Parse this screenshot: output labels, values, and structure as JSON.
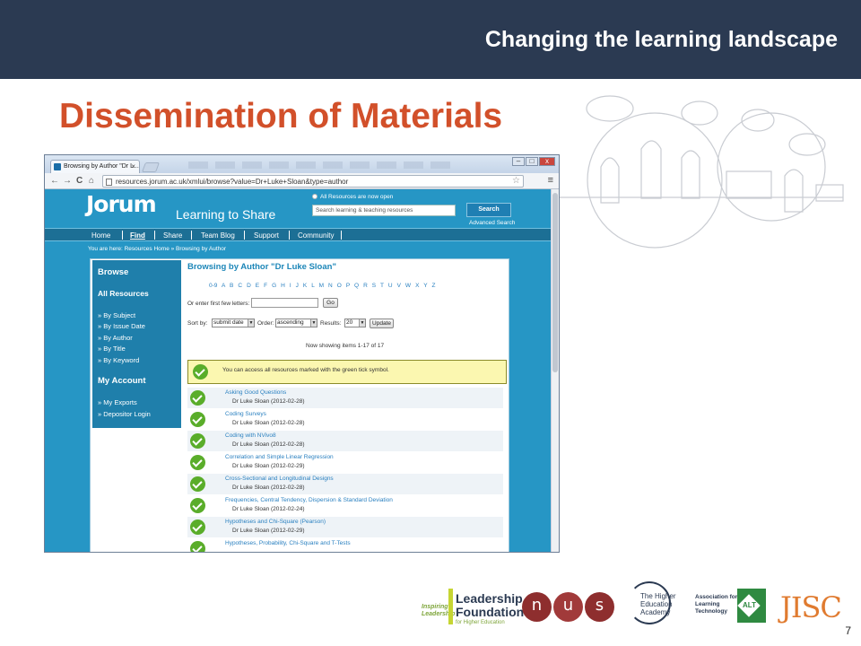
{
  "header": {
    "tagline": "Changing the learning landscape"
  },
  "slide": {
    "title": "Dissemination of Materials",
    "page_number": "7"
  },
  "browser": {
    "tab_title": "Browsing by Author \"Dr L...",
    "url": "resources.jorum.ac.uk/xmlui/browse?value=Dr+Luke+Sloan&type=author",
    "nav": {
      "back": "←",
      "forward": "→",
      "reload": "C",
      "home": "⌂",
      "menu": "≡",
      "star": "☆"
    },
    "window_buttons": [
      "–",
      "□",
      "x"
    ]
  },
  "jorum": {
    "logo": "Jorum",
    "tagline": "Learning to Share",
    "open_note": "All Resources are now open",
    "search_placeholder": "Search learning & teaching resources",
    "search_button": "Search",
    "advanced_search": "Advanced Search",
    "nav": [
      "Home",
      "Find",
      "Share",
      "Team Blog",
      "Support",
      "Community"
    ],
    "breadcrumb": "You are here: Resources Home » Browsing by Author",
    "sidebar": {
      "browse_heading": "Browse",
      "all_resources": "All Resources",
      "browse_items": [
        "» By Subject",
        "» By Issue Date",
        "» By Author",
        "» By Title",
        "» By Keyword"
      ],
      "account_heading": "My Account",
      "account_items": [
        "» My Exports",
        "» Depositor Login"
      ]
    },
    "browse_title": "Browsing by Author \"Dr Luke Sloan\"",
    "alphabet": "0-9 A B C D E F G H I J K L M N O P Q R S T U V W X Y Z",
    "first_letters_label": "Or enter first few letters:",
    "go_button": "Go",
    "sort_by_label": "Sort by:",
    "sort_by_value": "submit date",
    "order_label": "Order:",
    "order_value": "ascending",
    "results_label": "Results:",
    "results_value": "20",
    "update_button": "Update",
    "showing": "Now showing items 1-17 of 17",
    "notice": "You can access all resources marked with the green tick symbol.",
    "results": [
      {
        "title": "Asking Good Questions",
        "author": "Dr Luke Sloan (2012-02-28)"
      },
      {
        "title": "Coding Surveys",
        "author": "Dr Luke Sloan (2012-02-28)"
      },
      {
        "title": "Coding with NVivo8",
        "author": "Dr Luke Sloan (2012-02-28)"
      },
      {
        "title": "Correlation and Simple Linear Regression",
        "author": "Dr Luke Sloan (2012-02-29)"
      },
      {
        "title": "Cross-Sectional and Longitudinal Designs",
        "author": "Dr Luke Sloan (2012-02-28)"
      },
      {
        "title": "Frequencies, Central Tendency, Dispersion & Standard Deviation",
        "author": "Dr Luke Sloan (2012-02-24)"
      },
      {
        "title": "Hypotheses and Chi-Square (Pearson)",
        "author": "Dr Luke Sloan (2012-02-29)"
      },
      {
        "title": "Hypotheses, Probability, Chi-Square and T-Tests",
        "author": ""
      }
    ]
  },
  "logos": {
    "lf_inspiring": "Inspiring Leadership",
    "lf_title": "Leadership Foundation",
    "lf_sub": "for Higher Education",
    "nus": [
      "n",
      "u",
      "s"
    ],
    "hea": "The Higher Education Academy",
    "alt": "Association for Learning Technology",
    "alt_mark": "ALT",
    "jisc": "JISC"
  },
  "colors": {
    "header_band": "#2b3a52",
    "title": "#d2502a",
    "jorum_blue": "#2696c5",
    "tick_green": "#5aad2a"
  }
}
